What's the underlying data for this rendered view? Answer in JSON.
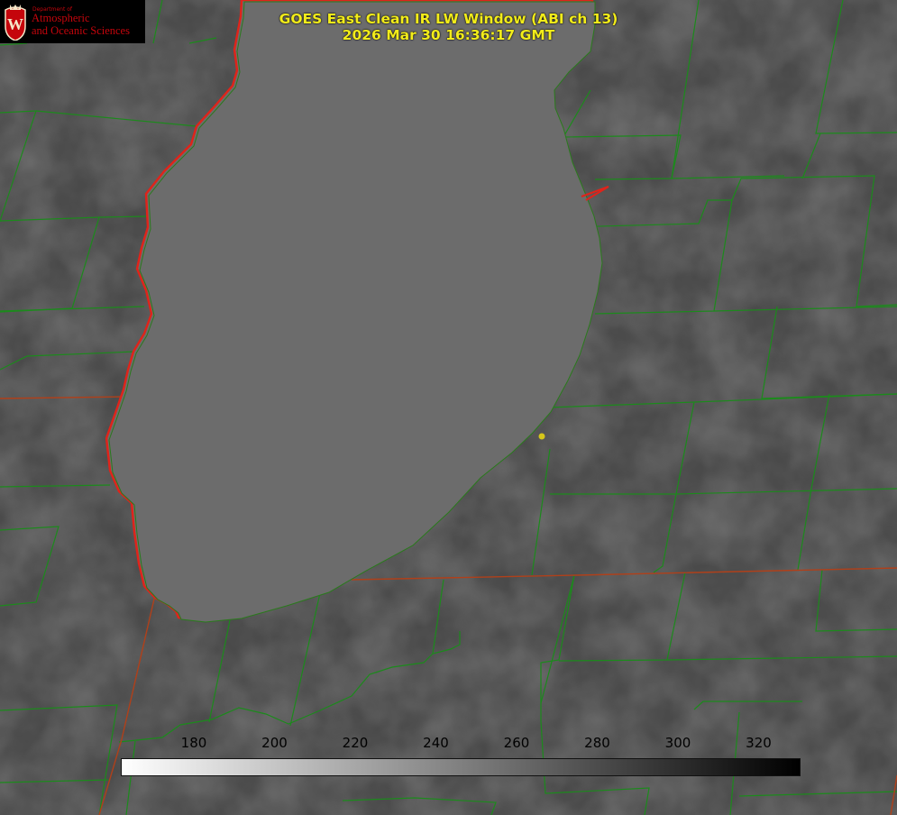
{
  "logo": {
    "department": "Department of",
    "line1": "Atmospheric",
    "line2": "and Oceanic Sciences",
    "seal_letter": "W",
    "color": "#c5050c"
  },
  "title": {
    "line1": "GOES East Clean IR LW Window (ABI ch 13)",
    "line2": "2026 Mar 30 16:36:17 GMT",
    "color": "#f2ec1a"
  },
  "colorbar": {
    "ticks": [
      "180",
      "200",
      "220",
      "240",
      "260",
      "280",
      "300",
      "320"
    ],
    "gradient": [
      "#ffffff",
      "#000000"
    ]
  },
  "colors": {
    "lake": "#6c6c6c",
    "land": "#4a4a4a",
    "county_lines": "#1c8a1c",
    "shoreline": "#e0231a",
    "state_lines": "#b0401a",
    "marker": "#d6c61a"
  }
}
